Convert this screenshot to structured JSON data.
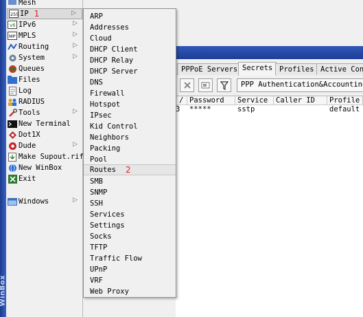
{
  "sidebar": {
    "brand_vertical": "WinBox",
    "items": [
      {
        "label": "Mesh",
        "icon": "mesh-icon",
        "submenu": false
      },
      {
        "label": "IP",
        "icon": "ip-icon",
        "submenu": true,
        "selected": true,
        "annotation": "1"
      },
      {
        "label": "IPv6",
        "icon": "ipv6-icon",
        "submenu": true
      },
      {
        "label": "MPLS",
        "icon": "mpls-icon",
        "submenu": true
      },
      {
        "label": "Routing",
        "icon": "routing-icon",
        "submenu": true
      },
      {
        "label": "System",
        "icon": "system-gear-icon",
        "submenu": true
      },
      {
        "label": "Queues",
        "icon": "queues-icon",
        "submenu": false
      },
      {
        "label": "Files",
        "icon": "folder-icon",
        "submenu": false
      },
      {
        "label": "Log",
        "icon": "log-icon",
        "submenu": false
      },
      {
        "label": "RADIUS",
        "icon": "radius-users-icon",
        "submenu": false
      },
      {
        "label": "Tools",
        "icon": "tools-icon",
        "submenu": true
      },
      {
        "label": "New Terminal",
        "icon": "terminal-icon",
        "submenu": false
      },
      {
        "label": "Dot1X",
        "icon": "dot1x-icon",
        "submenu": false
      },
      {
        "label": "Dude",
        "icon": "dude-icon",
        "submenu": true
      },
      {
        "label": "Make Supout.rif",
        "icon": "supout-icon",
        "submenu": false
      },
      {
        "label": "New WinBox",
        "icon": "winbox-globe-icon",
        "submenu": false
      },
      {
        "label": "Exit",
        "icon": "exit-icon",
        "submenu": false
      },
      {
        "label": "Windows",
        "icon": "windows-icon",
        "submenu": true
      }
    ]
  },
  "ip_submenu": {
    "items": [
      "ARP",
      "Addresses",
      "Cloud",
      "DHCP Client",
      "DHCP Relay",
      "DHCP Server",
      "DNS",
      "Firewall",
      "Hotspot",
      "IPsec",
      "Kid Control",
      "Neighbors",
      "Packing",
      "Pool",
      "Routes",
      "SMB",
      "SNMP",
      "SSH",
      "Services",
      "Settings",
      "Socks",
      "TFTP",
      "Traffic Flow",
      "UPnP",
      "VRF",
      "Web Proxy"
    ],
    "selected": "Routes",
    "annotation": "2"
  },
  "ppp_window": {
    "tabs": [
      "PPPoE Servers",
      "Secrets",
      "Profiles",
      "Active Conn"
    ],
    "active_tab": "Secrets",
    "toolbar": {
      "auth_button": "PPP Authentication&Accounting"
    },
    "columns": [
      "/",
      "Password",
      "Service",
      "Caller ID",
      "Profile"
    ],
    "rows": [
      {
        "index": "3",
        "password": "*****",
        "service": "sstp",
        "caller_id": "",
        "profile": "default"
      }
    ]
  },
  "colors": {
    "annotation_red": "#e0211e",
    "titlebar_blue": "#1d3e95",
    "strip_blue": "#2a4fb0"
  }
}
